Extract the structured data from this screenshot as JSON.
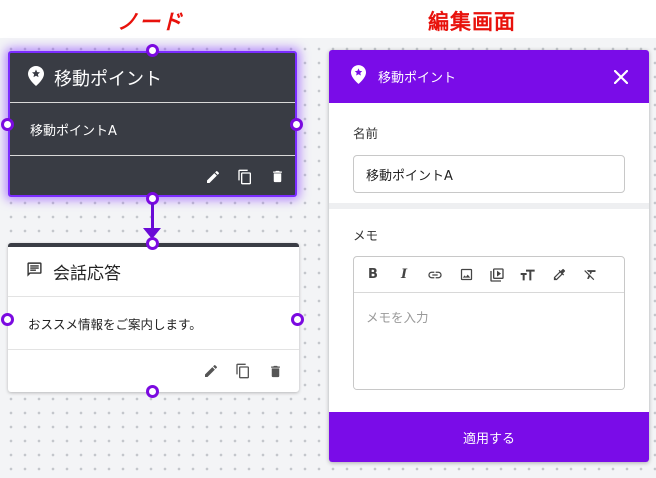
{
  "headings": {
    "node": "ノード",
    "edit_screen": "編集画面"
  },
  "colors": {
    "accent": "#7a0ce8",
    "heading_red": "#e8120c",
    "dark_node": "#393c44"
  },
  "nodes": [
    {
      "title": "移動ポイント",
      "icon": "location-star-icon",
      "body": "移動ポイントA",
      "selected": true,
      "actions": [
        "edit-icon",
        "copy-icon",
        "delete-icon"
      ]
    },
    {
      "title": "会話応答",
      "icon": "message-icon",
      "body": "おススメ情報をご案内します。",
      "selected": false,
      "actions": [
        "edit-icon",
        "copy-icon",
        "delete-icon"
      ]
    }
  ],
  "panel": {
    "title": "移動ポイント",
    "icon": "location-star-icon",
    "name_label": "名前",
    "name_value": "移動ポイントA",
    "memo_label": "メモ",
    "memo_placeholder": "メモを入力",
    "toolbar": [
      "bold",
      "italic",
      "link",
      "image",
      "video",
      "text-size",
      "color-picker",
      "clear-format"
    ],
    "bold_glyph": "B",
    "italic_glyph": "I",
    "apply_label": "適用する"
  }
}
